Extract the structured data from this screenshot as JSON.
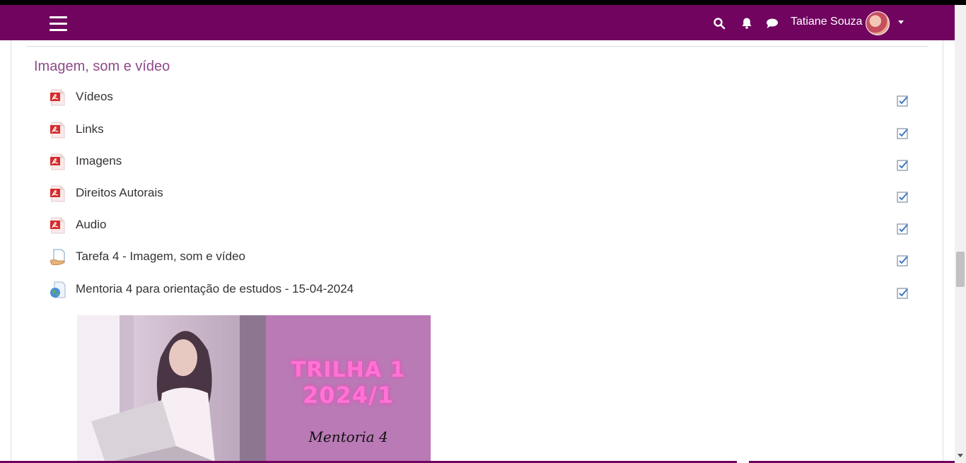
{
  "navbar": {
    "user_name": "Tatiane Souza",
    "icons": [
      "menu-icon",
      "search-icon",
      "bell-icon",
      "chat-icon",
      "chevron-down-icon"
    ],
    "color": "#70045f"
  },
  "section": {
    "title": "Imagem, som e vídeo",
    "title_color": "#8e4a89"
  },
  "activities": [
    {
      "name": "Vídeos",
      "icon": "pdf-icon",
      "completed": true
    },
    {
      "name": "Links",
      "icon": "pdf-icon",
      "completed": true
    },
    {
      "name": "Imagens",
      "icon": "pdf-icon",
      "completed": true
    },
    {
      "name": "Direitos Autorais",
      "icon": "pdf-icon",
      "completed": true
    },
    {
      "name": "Audio",
      "icon": "pdf-icon",
      "completed": true
    },
    {
      "name": "Tarefa 4 - Imagem, som e vídeo",
      "icon": "assignment-icon",
      "completed": true
    },
    {
      "name": "Mentoria 4 para orientação de estudos - 15-04-2024",
      "icon": "url-icon",
      "completed": true
    }
  ],
  "banner": {
    "line1": "TRILHA 1",
    "line2": "2024/1",
    "line3": "Mentoria 4",
    "panel_color": "#b97ab6",
    "text_color": "#ff73d6"
  }
}
